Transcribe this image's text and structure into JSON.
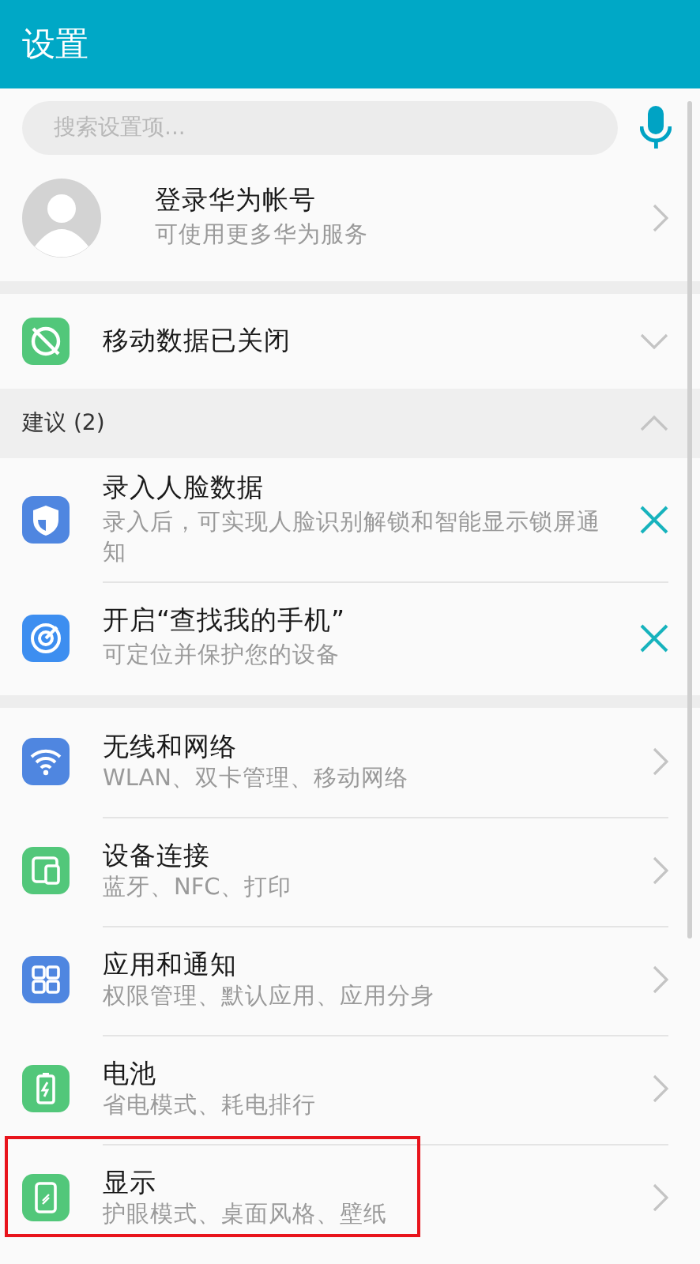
{
  "header": {
    "title": "设置"
  },
  "search": {
    "placeholder": "搜索设置项..."
  },
  "account": {
    "title": "登录华为帐号",
    "subtitle": "可使用更多华为服务"
  },
  "mobile_data": {
    "label": "移动数据已关闭",
    "expanded": false,
    "kind": "data-off",
    "color": "#52c77a"
  },
  "suggestions": {
    "title": "建议 (2)",
    "expanded": true,
    "items": [
      {
        "title": "录入人脸数据",
        "subtitle": "录入后，可实现人脸识别解锁和智能显示锁屏通知",
        "kind": "shield",
        "color": "#4f86e0"
      },
      {
        "title": "开启“查找我的手机”",
        "subtitle": "可定位并保护您的设备",
        "kind": "target",
        "color": "#3d8ef0"
      }
    ]
  },
  "settings": [
    {
      "title": "无线和网络",
      "subtitle": "WLAN、双卡管理、移动网络",
      "kind": "wifi",
      "color": "#4f86e0",
      "highlighted": false
    },
    {
      "title": "设备连接",
      "subtitle": "蓝牙、NFC、打印",
      "kind": "devices",
      "color": "#52c77a",
      "highlighted": false
    },
    {
      "title": "应用和通知",
      "subtitle": "权限管理、默认应用、应用分身",
      "kind": "apps",
      "color": "#4f86e0",
      "highlighted": false
    },
    {
      "title": "电池",
      "subtitle": "省电模式、耗电排行",
      "kind": "battery",
      "color": "#52c77a",
      "highlighted": false
    },
    {
      "title": "显示",
      "subtitle": "护眼模式、桌面风格、壁纸",
      "kind": "display",
      "color": "#52c77a",
      "highlighted": true
    }
  ]
}
